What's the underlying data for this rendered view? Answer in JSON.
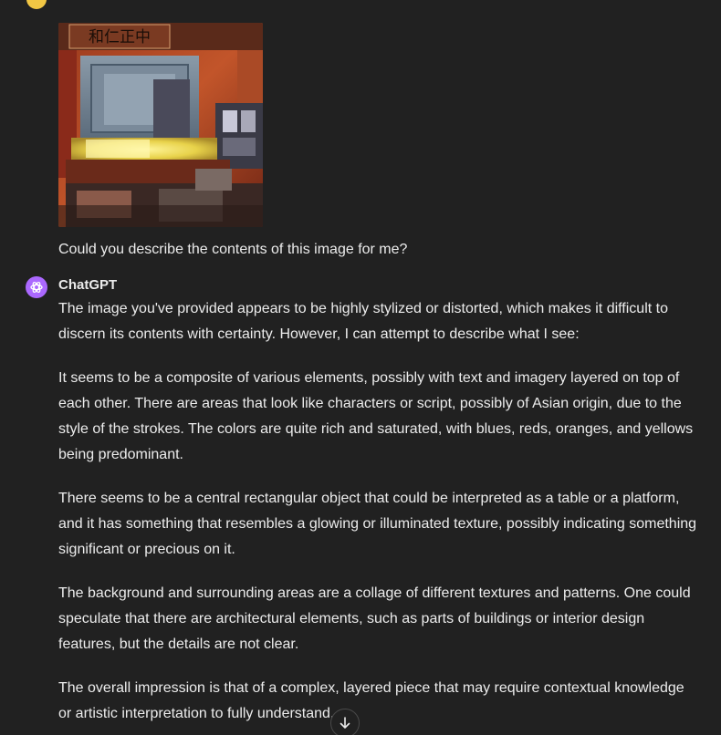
{
  "user": {
    "message": "Could you describe the contents of this image for me?",
    "avatar_color": "#f2c744",
    "image": {
      "sign_text": "和仁正中",
      "colors": [
        "#b34a22",
        "#6a7a8a",
        "#e8d24a",
        "#3a2a2a",
        "#8a2a1a"
      ]
    }
  },
  "assistant": {
    "name": "ChatGPT",
    "avatar_color": "#ab68ff",
    "avatar_icon": "openai-logo-icon",
    "paragraphs": [
      "The image you've provided appears to be highly stylized or distorted, which makes it difficult to discern its contents with certainty. However, I can attempt to describe what I see:",
      "It seems to be a composite of various elements, possibly with text and imagery layered on top of each other. There are areas that look like characters or script, possibly of Asian origin, due to the style of the strokes. The colors are quite rich and saturated, with blues, reds, oranges, and yellows being predominant.",
      "There seems to be a central rectangular object that could be interpreted as a table or a platform, and it has something that resembles a glowing or illuminated texture, possibly indicating something significant or precious on it.",
      "The background and surrounding areas are a collage of different textures and patterns. One could speculate that there are architectural elements, such as parts of buildings or interior design features, but the details are not clear.",
      "The overall impression is that of a complex, layered piece that may require contextual knowledge or artistic interpretation to fully understand."
    ]
  },
  "controls": {
    "scroll_down_icon": "arrow-down-icon"
  }
}
